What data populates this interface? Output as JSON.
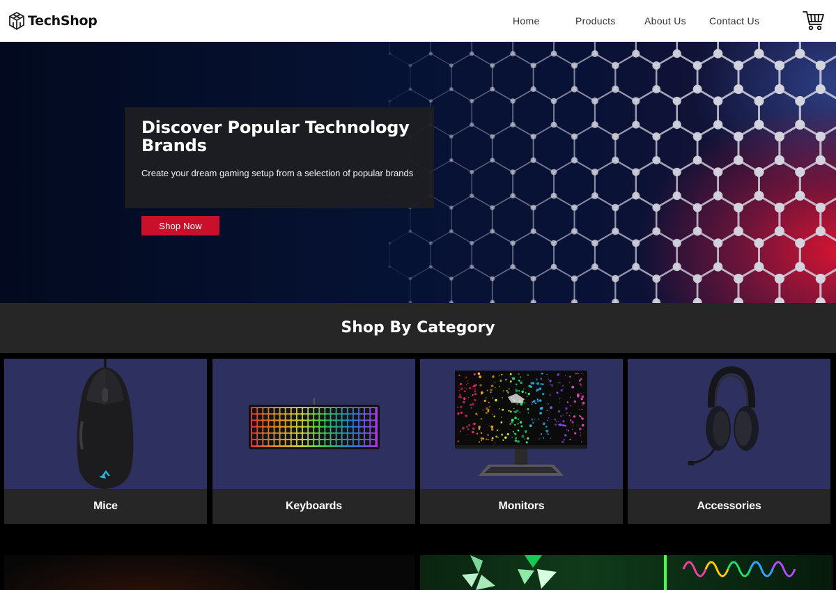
{
  "brand": {
    "name": "TechShop"
  },
  "nav": {
    "links": [
      {
        "label": "Home"
      },
      {
        "label": "Products"
      },
      {
        "label": "About Us"
      },
      {
        "label": "Contact Us"
      }
    ],
    "cart_icon": "cart-icon"
  },
  "hero": {
    "title": "Discover Popular Technology Brands",
    "subtitle": "Create your dream gaming setup from a selection of popular brands",
    "cta_label": "Shop Now",
    "cta_color": "#c9102a"
  },
  "categories": {
    "heading": "Shop By Category",
    "items": [
      {
        "label": "Mice",
        "image": "gaming-mouse-image"
      },
      {
        "label": "Keyboards",
        "image": "rgb-keyboard-image"
      },
      {
        "label": "Monitors",
        "image": "monitor-image"
      },
      {
        "label": "Accessories",
        "image": "headset-image"
      }
    ]
  },
  "colors": {
    "card_background": "#2e3160",
    "label_background": "#262626",
    "accent_red": "#c9102a"
  }
}
